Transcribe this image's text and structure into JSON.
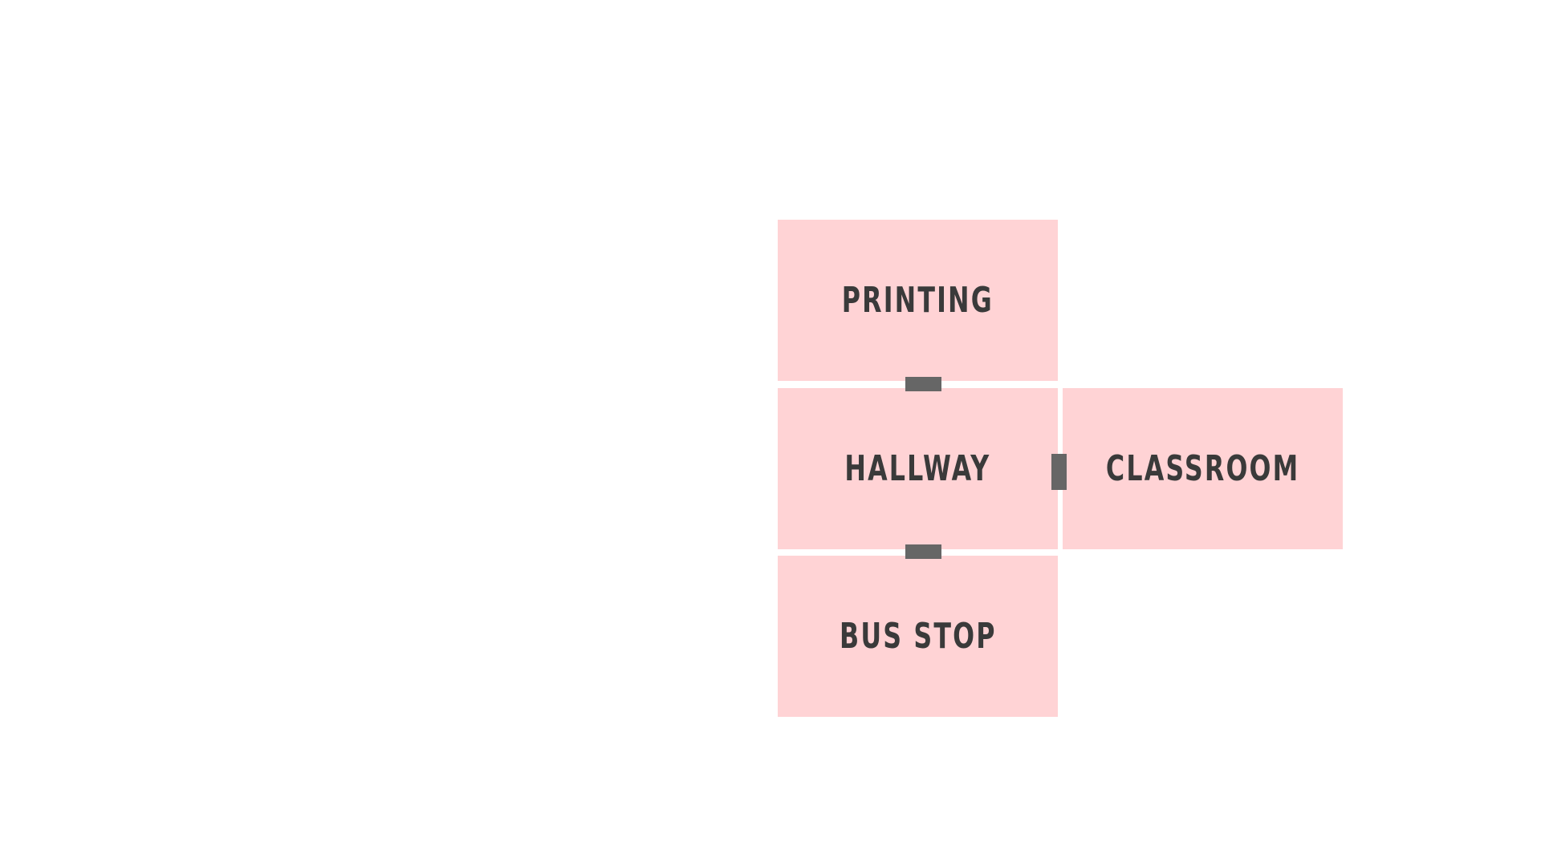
{
  "map": {
    "rooms": {
      "printing": {
        "label": "PRINTING"
      },
      "hallway": {
        "label": "HALLWAY"
      },
      "classroom": {
        "label": "CLASSROOM"
      },
      "busstop": {
        "label": "BUS STOP"
      }
    },
    "doors": [
      {
        "from": "printing",
        "to": "hallway"
      },
      {
        "from": "hallway",
        "to": "busstop"
      },
      {
        "from": "hallway",
        "to": "classroom"
      }
    ],
    "colors": {
      "background": "#ffffff",
      "room_fill": "#ffd3d5",
      "label_text": "#3a3a3a",
      "door": "#666666"
    }
  }
}
